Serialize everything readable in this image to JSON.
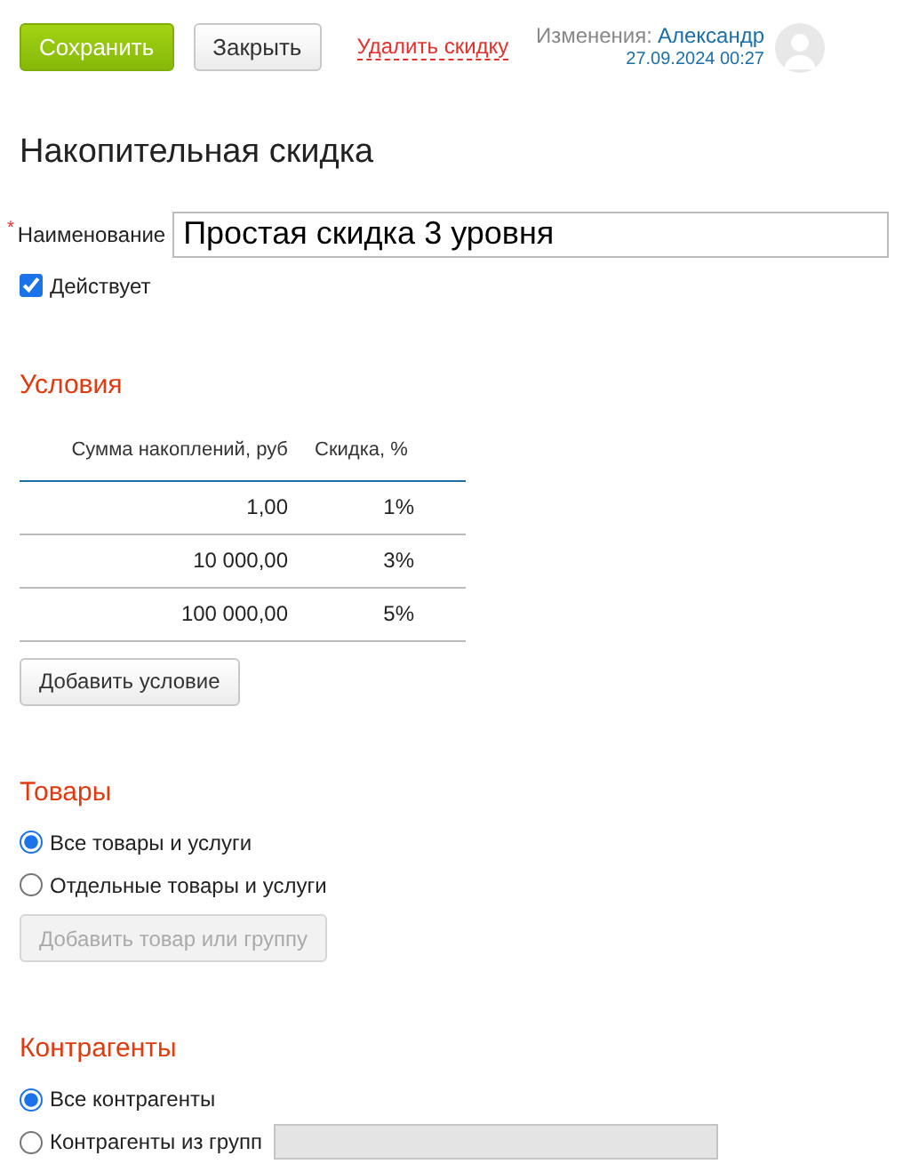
{
  "toolbar": {
    "save": "Сохранить",
    "close": "Закрыть",
    "delete_link": "Удалить скидку",
    "changes_label": "Изменения:",
    "changes_user": "Александр",
    "changes_time": "27.09.2024 00:27"
  },
  "title": "Накопительная скидка",
  "name_field": {
    "label": "Наименование",
    "required_mark": "*",
    "value": "Простая скидка 3 уровня"
  },
  "active": {
    "label": "Действует",
    "checked": true
  },
  "conditions": {
    "heading": "Условия",
    "columns": [
      "Сумма накоплений, руб",
      "Скидка, %"
    ],
    "rows": [
      {
        "sum": "1,00",
        "discount": "1%"
      },
      {
        "sum": "10 000,00",
        "discount": "3%"
      },
      {
        "sum": "100 000,00",
        "discount": "5%"
      }
    ],
    "add_button": "Добавить условие"
  },
  "goods": {
    "heading": "Товары",
    "options": [
      {
        "label": "Все товары и услуги",
        "selected": true
      },
      {
        "label": "Отдельные товары и услуги",
        "selected": false
      }
    ],
    "add_button": {
      "label": "Добавить товар или группу",
      "disabled": true
    }
  },
  "contractors": {
    "heading": "Контрагенты",
    "options": [
      {
        "label": "Все контрагенты",
        "selected": true
      },
      {
        "label": "Контрагенты из групп",
        "selected": false,
        "field_disabled": true
      }
    ]
  }
}
